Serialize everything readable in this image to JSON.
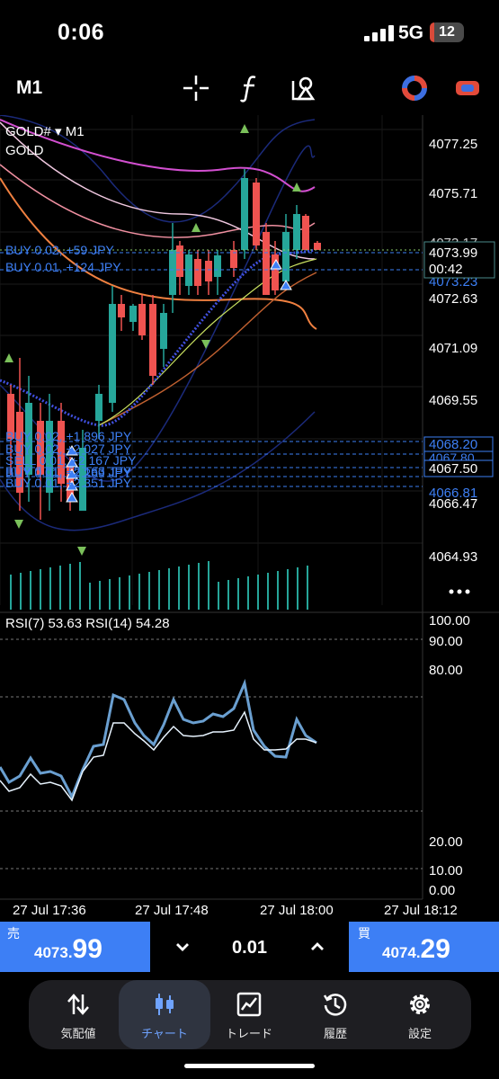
{
  "status": {
    "time": "0:06",
    "network": "5G",
    "battery": "12",
    "battery_level": 0.12
  },
  "toolbar": {
    "timeframe": "M1",
    "icons": [
      "crosshair-icon",
      "function-icon",
      "objects-icon",
      "indicator-ring-icon",
      "window-switch-icon"
    ]
  },
  "chart": {
    "symbol_line": "GOLD# ▾ M1",
    "description": "GOLD",
    "current_price": "4073.99",
    "countdown": "00:42",
    "price_axis": [
      "4077.25",
      "4075.71",
      "4072.63",
      "4071.09",
      "4069.55",
      "4066.47",
      "4064.93"
    ],
    "partial_axis_labels": [
      "4073.17",
      "4073.23",
      "4066.81"
    ],
    "order_price_tags": [
      "4068.20",
      "4067.80",
      "4067.50"
    ],
    "positions_top": [
      "BUY 0.02, +59 JPY",
      "BUY 0.01, +124 JPY"
    ],
    "positions_bottom": [
      "BUY 0.02, +1 896 JPY",
      "BUY 0.02, +2 027 JPY",
      "SELL 0.01, +2 167 JPY",
      "BUY 0.01, +2 163 JPY",
      "BUY 0.01, +2 269 JPY",
      "BUY 0.01, +2 351 JPY"
    ],
    "more_icon": "more-icon"
  },
  "rsi": {
    "label": "RSI(7) 53.63 RSI(14) 54.28",
    "axis": [
      "100.00",
      "90.00",
      "80.00",
      "20.00",
      "10.00",
      "0.00"
    ]
  },
  "time_axis": [
    "27 Jul 17:36",
    "27 Jul 17:48",
    "27 Jul 18:00",
    "27 Jul 18:12"
  ],
  "trade": {
    "sell_label": "売",
    "sell_small": "4073.",
    "sell_big": "99",
    "buy_label": "買",
    "buy_small": "4074.",
    "buy_big": "29",
    "lot": "0.01",
    "colors": {
      "panel": "#3d7ff5",
      "candle_up": "#26a69a",
      "candle_down": "#ef5350"
    }
  },
  "tabs": [
    {
      "label": "気配値",
      "icon": "quotes-icon"
    },
    {
      "label": "チャート",
      "icon": "chart-icon"
    },
    {
      "label": "トレード",
      "icon": "trade-icon"
    },
    {
      "label": "履歴",
      "icon": "history-icon"
    },
    {
      "label": "設定",
      "icon": "settings-icon"
    }
  ]
}
